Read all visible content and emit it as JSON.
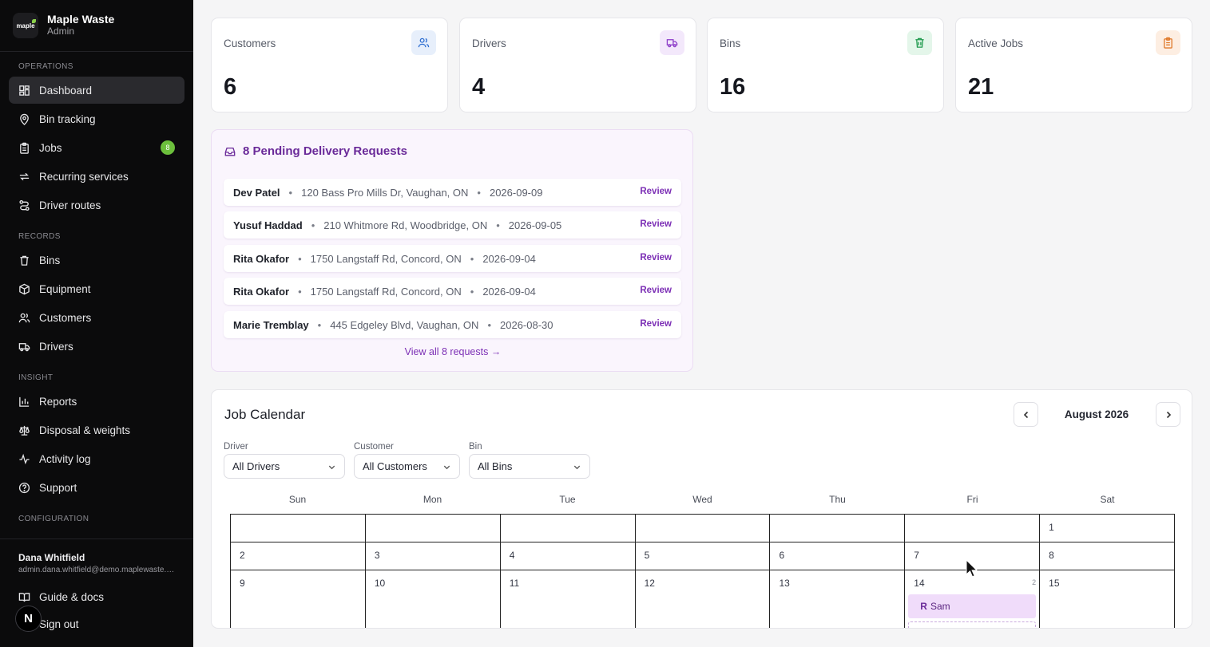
{
  "sidebar": {
    "brand_name": "Maple Waste",
    "brand_role": "Admin",
    "logo_text": "maple",
    "sections": {
      "operations": "OPERATIONS",
      "records": "RECORDS",
      "insight": "INSIGHT",
      "configuration": "CONFIGURATION"
    },
    "items": [
      {
        "label": "Dashboard",
        "icon": "dashboard-icon",
        "active": true
      },
      {
        "label": "Bin tracking",
        "icon": "map-pin-icon"
      },
      {
        "label": "Jobs",
        "icon": "clipboard-icon",
        "badge": "8"
      },
      {
        "label": "Recurring services",
        "icon": "repeat-icon"
      },
      {
        "label": "Driver routes",
        "icon": "route-icon"
      },
      {
        "label": "Bins",
        "icon": "trash-icon"
      },
      {
        "label": "Equipment",
        "icon": "package-icon"
      },
      {
        "label": "Customers",
        "icon": "users-icon"
      },
      {
        "label": "Drivers",
        "icon": "truck-icon"
      },
      {
        "label": "Reports",
        "icon": "bar-chart-icon"
      },
      {
        "label": "Disposal & weights",
        "icon": "scale-icon"
      },
      {
        "label": "Activity log",
        "icon": "activity-icon"
      },
      {
        "label": "Support",
        "icon": "help-circle-icon"
      }
    ],
    "user_name": "Dana Whitfield",
    "user_email": "admin.dana.whitfield@demo.maplewaste.com",
    "guide_label": "Guide & docs",
    "signout_label": "Sign out",
    "n_badge": "N"
  },
  "stats": [
    {
      "label": "Customers",
      "value": "6",
      "icon": "users-icon",
      "color": "#2f6fd1",
      "bg": "#e7effb"
    },
    {
      "label": "Drivers",
      "value": "4",
      "icon": "truck-icon",
      "color": "#8e3fc9",
      "bg": "#f3e8fb"
    },
    {
      "label": "Bins",
      "value": "16",
      "icon": "trash-icon",
      "color": "#1f9a4d",
      "bg": "#e4f6ea"
    },
    {
      "label": "Active Jobs",
      "value": "21",
      "icon": "clipboard-icon",
      "color": "#e07a2c",
      "bg": "#fdeee2"
    }
  ],
  "pending": {
    "title": "8 Pending Delivery Requests",
    "requests": [
      {
        "name": "Dev Patel",
        "address": "120 Bass Pro Mills Dr, Vaughan, ON",
        "date": "2026-09-09",
        "action": "Review"
      },
      {
        "name": "Yusuf Haddad",
        "address": "210 Whitmore Rd, Woodbridge, ON",
        "date": "2026-09-05",
        "action": "Review"
      },
      {
        "name": "Rita Okafor",
        "address": "1750 Langstaff Rd, Concord, ON",
        "date": "2026-09-04",
        "action": "Review"
      },
      {
        "name": "Rita Okafor",
        "address": "1750 Langstaff Rd, Concord, ON",
        "date": "2026-09-04",
        "action": "Review"
      },
      {
        "name": "Marie Tremblay",
        "address": "445 Edgeley Blvd, Vaughan, ON",
        "date": "2026-08-30",
        "action": "Review"
      }
    ],
    "separator": "•",
    "view_all": "View all 8 requests →"
  },
  "calendar": {
    "title": "Job Calendar",
    "month": "August 2026",
    "filters": [
      {
        "label": "Driver",
        "value": "All Drivers"
      },
      {
        "label": "Customer",
        "value": "All Customers"
      },
      {
        "label": "Bin",
        "value": "All Bins"
      }
    ],
    "weekdays": [
      "Sun",
      "Mon",
      "Tue",
      "Wed",
      "Thu",
      "Fri",
      "Sat"
    ],
    "weeks": [
      [
        "",
        "",
        "",
        "",
        "",
        "",
        "1"
      ],
      [
        "2",
        "3",
        "4",
        "5",
        "6",
        "7",
        "8"
      ],
      [
        "9",
        "10",
        "11",
        "12",
        "13",
        "14",
        "15"
      ]
    ],
    "event_count": "2",
    "event": {
      "badge": "R",
      "label": "Sam"
    }
  }
}
